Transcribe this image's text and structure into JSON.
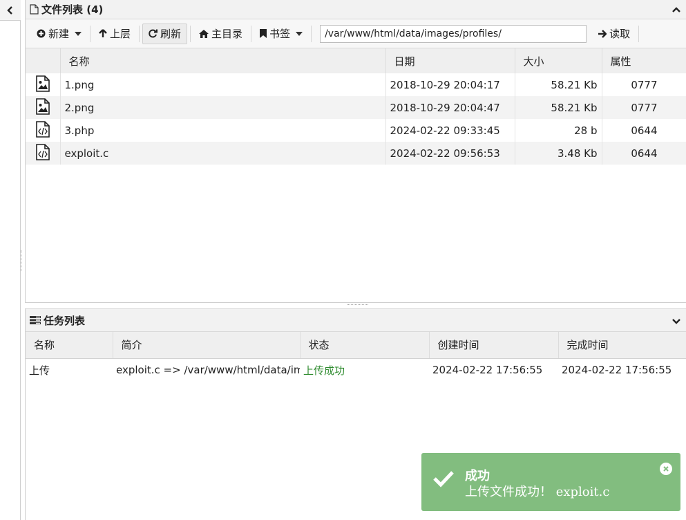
{
  "file_panel": {
    "title": "文件列表 (4)",
    "toolbar": {
      "new_label": "新建",
      "up_label": "上层",
      "refresh_label": "刷新",
      "home_label": "主目录",
      "bookmark_label": "书签",
      "path_value": "/var/www/html/data/images/profiles/",
      "read_label": "读取"
    },
    "columns": {
      "name": "名称",
      "date": "日期",
      "size": "大小",
      "attr": "属性"
    },
    "files": [
      {
        "icon": "image-file-icon",
        "name": "1.png",
        "date": "2018-10-29 20:04:17",
        "size": "58.21 Kb",
        "attr": "0777"
      },
      {
        "icon": "image-file-icon",
        "name": "2.png",
        "date": "2018-10-29 20:04:47",
        "size": "58.21 Kb",
        "attr": "0777"
      },
      {
        "icon": "code-file-icon",
        "name": "3.php",
        "date": "2024-02-22 09:33:45",
        "size": "28 b",
        "attr": "0644"
      },
      {
        "icon": "code-file-icon",
        "name": "exploit.c",
        "date": "2024-02-22 09:56:53",
        "size": "3.48 Kb",
        "attr": "0644"
      }
    ]
  },
  "task_panel": {
    "title": "任务列表",
    "columns": {
      "name": "名称",
      "desc": "简介",
      "status": "状态",
      "created": "创建时间",
      "finished": "完成时间"
    },
    "tasks": [
      {
        "name": "上传",
        "desc": "exploit.c => /var/www/html/data/im",
        "status": "上传成功",
        "created": "2024-02-22 17:56:55",
        "finished": "2024-02-22 17:56:55"
      }
    ]
  },
  "toast": {
    "title": "成功",
    "message": "上传文件成功！ exploit.c",
    "color": "#82bd7f"
  }
}
